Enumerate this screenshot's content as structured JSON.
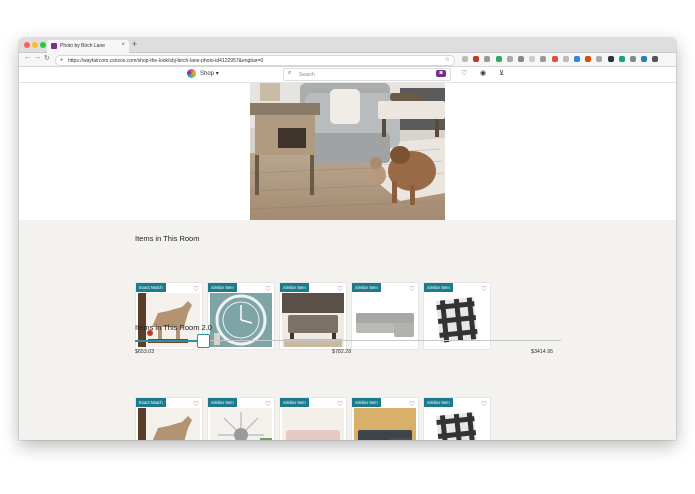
{
  "browser": {
    "tab_title": "Photo by Birch Lane",
    "tab_close": "×",
    "new_tab": "+",
    "url": "https://wayfaircom.csnzoo.com/shop-the-look/sbj-birch-lane-photo-id4122957&engbar=0",
    "nav": {
      "back": "←",
      "forward": "→",
      "reload": "↻"
    },
    "extension_colors": [
      "#bbbbbb",
      "#c0392b",
      "#999999",
      "#27ae60",
      "#aaaaaa",
      "#888888",
      "#cccccc",
      "#999999",
      "#e74c3c",
      "#bbbbbb",
      "#2e86de",
      "#d35400",
      "#aaaaaa",
      "#2d3436",
      "#16a085",
      "#7f8c8d",
      "#2980b9",
      "#555555"
    ]
  },
  "site_header": {
    "shop_label": "Shop",
    "shop_caret": "▾",
    "search_placeholder": "Search",
    "search_icon": "⌕",
    "camera_icon": "◙",
    "icons": [
      "idea-board-icon",
      "account-icon",
      "cart-icon"
    ],
    "icon_glyphs": [
      "♡",
      "◉",
      "⊻"
    ],
    "accent_color": "#7b2f8a"
  },
  "room_section": {
    "title": "Items in This Room",
    "items": [
      {
        "badge": "Exact Match",
        "image": "horse-statue"
      },
      {
        "badge": "Similar Item",
        "image": "wall-clock"
      },
      {
        "badge": "Similar Item",
        "image": "ottoman"
      },
      {
        "badge": "Similar Item",
        "image": "sectional-sofa"
      },
      {
        "badge": "Similar Item",
        "image": "plaid-pillow"
      }
    ]
  },
  "room_section_2": {
    "title": "Items in This Room 2.0",
    "price_min": "$653.03",
    "price_mid": "$782.28",
    "price_max": "$3414.95",
    "slider_position": 0.16,
    "items": [
      {
        "badge": "Exact Match",
        "image": "horse-statue"
      },
      {
        "badge": "Similar Item",
        "image": "starburst-mirror"
      },
      {
        "badge": "Similar Item",
        "image": "pink-sofa"
      },
      {
        "badge": "Similar Item",
        "image": "dark-sectional"
      },
      {
        "badge": "Similar Item",
        "image": "plaid-pillow"
      }
    ]
  },
  "favorite_icon": "♡",
  "badge_color": "#1b7b8c"
}
